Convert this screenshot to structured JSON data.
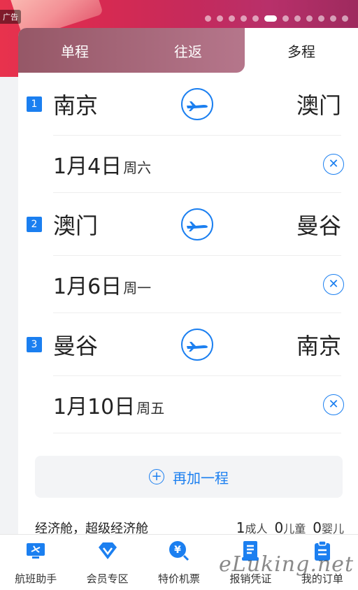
{
  "ad": {
    "tag": "广告",
    "slides": 12,
    "active_slide": 5
  },
  "tabs": [
    {
      "label": "单程",
      "active": false
    },
    {
      "label": "往返",
      "active": false
    },
    {
      "label": "多程",
      "active": true
    }
  ],
  "segments": [
    {
      "num": "1",
      "from": "南京",
      "to": "澳门",
      "date": "1月4日",
      "week": "周六"
    },
    {
      "num": "2",
      "from": "澳门",
      "to": "曼谷",
      "date": "1月6日",
      "week": "周一"
    },
    {
      "num": "3",
      "from": "曼谷",
      "to": "南京",
      "date": "1月10日",
      "week": "周五"
    }
  ],
  "add_segment_label": "再加一程",
  "cabin": {
    "label": "经济舱，超级经济舱"
  },
  "passengers": {
    "adult_count": "1",
    "adult_label": "成人",
    "child_count": "0",
    "child_label": "儿童",
    "infant_count": "0",
    "infant_label": "婴儿"
  },
  "bottom_nav": [
    {
      "label": "航班助手",
      "icon": "flight-monitor-icon"
    },
    {
      "label": "会员专区",
      "icon": "vip-diamond-icon"
    },
    {
      "label": "特价机票",
      "icon": "yen-search-icon"
    },
    {
      "label": "报销凭证",
      "icon": "receipt-icon"
    },
    {
      "label": "我的订单",
      "icon": "clipboard-icon"
    }
  ],
  "watermark": "eLuking.net",
  "colors": {
    "accent": "#1b7ff0",
    "banner": "#d62a52"
  }
}
